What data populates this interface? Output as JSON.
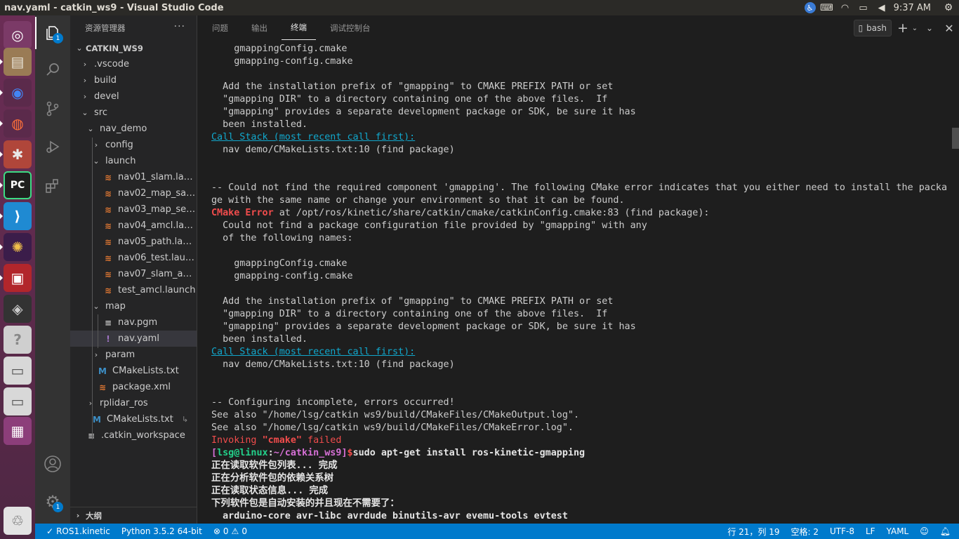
{
  "window": {
    "title": "nav.yaml - catkin_ws9 - Visual Studio Code"
  },
  "tray": {
    "time": "9:37 AM",
    "icons": [
      "accessibility-icon",
      "keyboard-icon",
      "wifi-icon",
      "battery-icon",
      "volume-icon",
      "settings-gear-icon"
    ]
  },
  "launcher": {
    "items": [
      {
        "name": "dash-home-icon",
        "glyph": "◎",
        "color": "#ffffff",
        "bg": "#7b3a67"
      },
      {
        "name": "file-manager-icon",
        "glyph": "▤",
        "color": "#e9e4d8",
        "bg": "#9a7b55"
      },
      {
        "name": "chrome-icon",
        "glyph": "◉",
        "color": "#4285f4",
        "bg": "#5b2a4b"
      },
      {
        "name": "firefox-icon",
        "glyph": "◍",
        "color": "#ff7139",
        "bg": "#5b2a4b"
      },
      {
        "name": "system-settings-icon",
        "glyph": "✱",
        "color": "#e8e8e8",
        "bg": "#b0463a"
      },
      {
        "name": "pycharm-icon",
        "glyph": "PC",
        "color": "#ffffff",
        "bg": "#1f1f1f"
      },
      {
        "name": "vscode-icon",
        "glyph": "⟩",
        "color": "#ffffff",
        "bg": "#1f8ad2"
      },
      {
        "name": "rviz-icon",
        "glyph": "✺",
        "color": "#f0c04a",
        "bg": "#3b1d4a"
      },
      {
        "name": "terminal-app-icon",
        "glyph": "▣",
        "color": "#ffffff",
        "bg": "#b2262b"
      },
      {
        "name": "update-icon",
        "glyph": "◈",
        "color": "#cccccc",
        "bg": "#333333"
      },
      {
        "name": "help-icon",
        "glyph": "?",
        "color": "#888888",
        "bg": "#cfcfcf"
      },
      {
        "name": "disk-icon",
        "glyph": "▭",
        "color": "#555555",
        "bg": "#d8d8d8"
      },
      {
        "name": "disk2-icon",
        "glyph": "▭",
        "color": "#555555",
        "bg": "#d8d8d8"
      },
      {
        "name": "workspace-switcher-icon",
        "glyph": "▦",
        "color": "#ffffff",
        "bg": "#8c3e7a"
      },
      {
        "name": "trash-icon",
        "glyph": "♲",
        "color": "#555555",
        "bg": "#e3e3e3"
      }
    ]
  },
  "activity": {
    "explorer_badge": "1",
    "settings_badge": "1"
  },
  "sidebar": {
    "header": "资源管理器",
    "more": "···",
    "root": "CATKIN_WS9",
    "tree": [
      {
        "label": ".vscode",
        "type": "folder"
      },
      {
        "label": "build",
        "type": "folder"
      },
      {
        "label": "devel",
        "type": "folder"
      },
      {
        "label": "src",
        "type": "folder-open"
      },
      {
        "label": "nav_demo",
        "type": "folder-open"
      },
      {
        "label": "config",
        "type": "folder"
      },
      {
        "label": "launch",
        "type": "folder-open"
      },
      {
        "label": "nav01_slam.launch",
        "type": "rss"
      },
      {
        "label": "nav02_map_sav...",
        "type": "rss"
      },
      {
        "label": "nav03_map_serv...",
        "type": "rss"
      },
      {
        "label": "nav04_amcl.launch",
        "type": "rss"
      },
      {
        "label": "nav05_path.launch",
        "type": "rss"
      },
      {
        "label": "nav06_test.launch",
        "type": "rss"
      },
      {
        "label": "nav07_slam_aut...",
        "type": "rss"
      },
      {
        "label": "test_amcl.launch",
        "type": "rss"
      },
      {
        "label": "map",
        "type": "folder-open"
      },
      {
        "label": "nav.pgm",
        "type": "lines"
      },
      {
        "label": "nav.yaml",
        "type": "yaml"
      },
      {
        "label": "param",
        "type": "folder"
      },
      {
        "label": "CMakeLists.txt",
        "type": "cmake"
      },
      {
        "label": "package.xml",
        "type": "rss"
      },
      {
        "label": "rplidar_ros",
        "type": "folder"
      },
      {
        "label": "CMakeLists.txt",
        "type": "cmake"
      },
      {
        "label": ".catkin_workspace",
        "type": "lines"
      }
    ],
    "outline": "大纲"
  },
  "panel": {
    "tabs": [
      "问题",
      "输出",
      "终端",
      "调试控制台"
    ],
    "active_tab": "终端",
    "terminal_select": "bash"
  },
  "terminal": {
    "lines": [
      "    gmappingConfig.cmake",
      "    gmapping-config.cmake",
      "",
      "  Add the installation prefix of \"gmapping\" to CMAKE PREFIX PATH or set",
      "  \"gmapping DIR\" to a directory containing one of the above files.  If",
      "  \"gmapping\" provides a separate development package or SDK, be sure it has",
      "  been installed.",
      "Call Stack (most recent call first):",
      "  nav demo/CMakeLists.txt:10 (find package)",
      "",
      "",
      "-- Could not find the required component 'gmapping'. The following CMake error indicates that you either need to install the packa",
      "ge with the same name or change your environment so that it can be found.",
      "CMake Error at /opt/ros/kinetic/share/catkin/cmake/catkinConfig.cmake:83 (find package):",
      "  Could not find a package configuration file provided by \"gmapping\" with any",
      "  of the following names:",
      "",
      "    gmappingConfig.cmake",
      "    gmapping-config.cmake",
      "",
      "  Add the installation prefix of \"gmapping\" to CMAKE PREFIX PATH or set",
      "  \"gmapping DIR\" to a directory containing one of the above files.  If",
      "  \"gmapping\" provides a separate development package or SDK, be sure it has",
      "  been installed.",
      "Call Stack (most recent call first):",
      "  nav demo/CMakeLists.txt:10 (find package)",
      "",
      "",
      "-- Configuring incomplete, errors occurred!",
      "See also \"/home/lsg/catkin ws9/build/CMakeFiles/CMakeOutput.log\".",
      "See also \"/home/lsg/catkin ws9/build/CMakeFiles/CMakeError.log\".",
      "Invoking \"cmake\" failed",
      "[lsg@linux:~/catkin_ws9]$sudo apt-get install ros-kinetic-gmapping",
      "正在读取软件包列表... 完成",
      "正在分析软件包的依赖关系树",
      "正在读取状态信息... 完成",
      "下列软件包是自动安装的并且现在不需要了：",
      "  arduino-core avr-libc avrdude binutils-avr evemu-tools evtest"
    ],
    "cmake_error_label": "CMake Error",
    "cmake_error_rest": " at /opt/ros/kinetic/share/catkin/cmake/catkinConfig.cmake:83 (find package):",
    "invoking_pre": "Invoking ",
    "invoking_cmd": "\"cmake\"",
    "invoking_post": " failed",
    "prompt_bracket_open": "[",
    "prompt_user": "lsg@linux",
    "prompt_colon": ":",
    "prompt_path": "~/catkin_ws9",
    "prompt_bracket_close": "]",
    "prompt_dollar": "$",
    "prompt_cmd": "sudo apt-get install ros-kinetic-gmapping"
  },
  "statusbar": {
    "ros": "ROS1.kinetic",
    "python": "Python 3.5.2 64-bit",
    "errors": "0",
    "warnings": "0",
    "position": "行 21，列 19",
    "spaces": "空格: 2",
    "encoding": "UTF-8",
    "eol": "LF",
    "language": "YAML"
  }
}
